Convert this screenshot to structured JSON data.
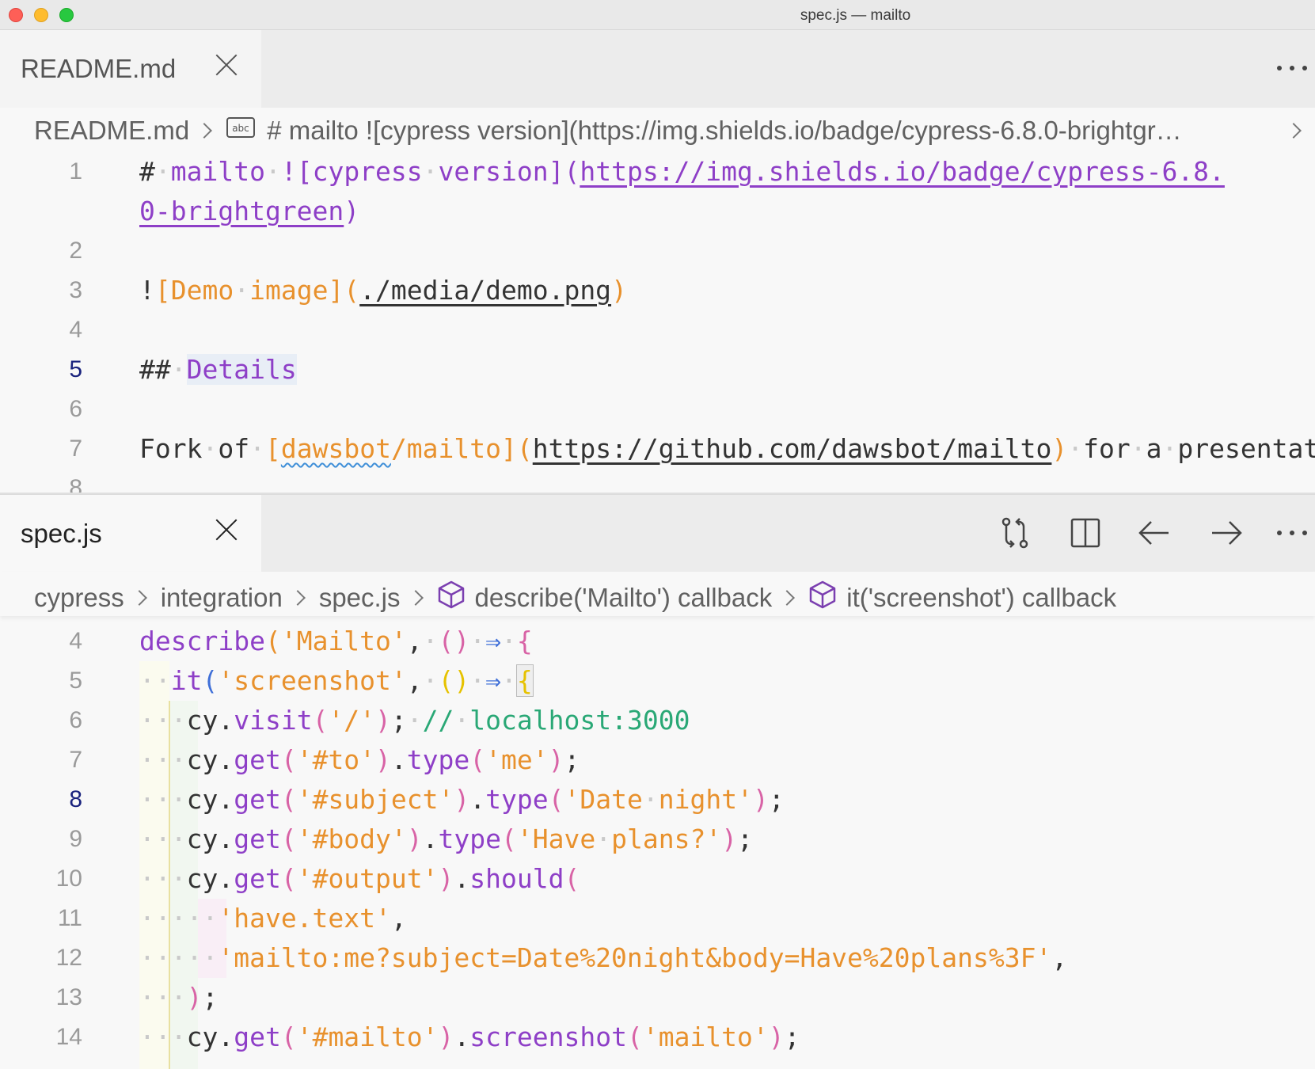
{
  "window": {
    "title": "spec.js — mailto"
  },
  "top_pane": {
    "tab": {
      "label": "README.md"
    },
    "breadcrumb": {
      "file": "README.md",
      "symbol": "# mailto ![cypress version](https://img.shields.io/badge/cypress-6.8.0-brightgr…"
    },
    "line_numbers": [
      "1",
      "2",
      "3",
      "4",
      "5",
      "6",
      "7",
      "8"
    ]
  },
  "bottom_pane": {
    "tab": {
      "label": "spec.js"
    },
    "breadcrumb": {
      "items": [
        "cypress",
        "integration",
        "spec.js",
        "describe('Mailto') callback",
        "it('screenshot') callback"
      ]
    },
    "line_numbers": [
      "4",
      "5",
      "6",
      "7",
      "8",
      "9",
      "10",
      "11",
      "12",
      "13",
      "14"
    ]
  },
  "icons": {
    "tab_close": "close-icon",
    "more": "more-actions-icon",
    "compare": "open-changes-icon",
    "split": "split-editor-icon",
    "back": "arrow-left-icon",
    "forward": "arrow-right-icon",
    "text_symbol": "abc-icon",
    "method_symbol": "cube-icon"
  },
  "colors": {
    "heading_purple": "#8e3fc7",
    "string_orange": "#e8912d",
    "comment_green": "#2aa876",
    "arrow_blue": "#3f6fd8",
    "current_line_number": "#1a237e"
  }
}
